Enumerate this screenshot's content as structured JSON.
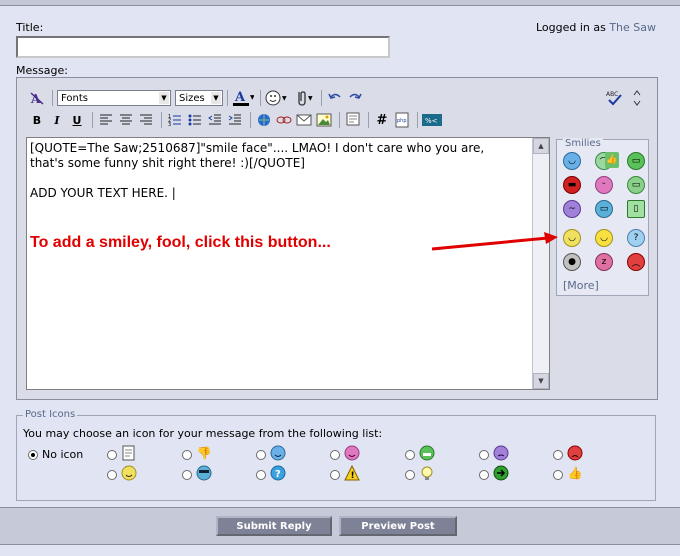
{
  "header": {
    "title_label": "Title:",
    "logged_in_prefix": "Logged in as",
    "username": "The Saw",
    "message_label": "Message:"
  },
  "toolbar": {
    "font_select": "Fonts",
    "size_select": "Sizes"
  },
  "editor": {
    "text": "[QUOTE=The Saw;2510687]\"smile face\".... LMAO! I don't care who you are, that's some funny shit right there! :)[/QUOTE]\n\nADD YOUR TEXT HERE. |"
  },
  "smilies": {
    "legend": "Smilies",
    "more": "[More]",
    "icons": [
      "smile-icon",
      "frown-icon",
      "thumbs-icon",
      "grin-icon",
      "mad-icon",
      "tongue-icon",
      "biggrin-icon",
      "confused-icon",
      "cool-icon",
      "eek-icon",
      "smiley-happy-icon",
      "wink-icon",
      "question-icon",
      "shock-icon",
      "sleep-icon",
      "angry-icon"
    ]
  },
  "annotation": "To add a smiley, fool, click this button...",
  "post_icons": {
    "legend": "Post Icons",
    "description": "You may choose an icon for your message from the following list:",
    "no_icon_label": "No icon"
  },
  "buttons": {
    "submit": "Submit Reply",
    "preview": "Preview Post"
  },
  "colors": {
    "annotation": "#e00000",
    "button_bg": "#7d8296",
    "link": "#5a6a8a"
  }
}
